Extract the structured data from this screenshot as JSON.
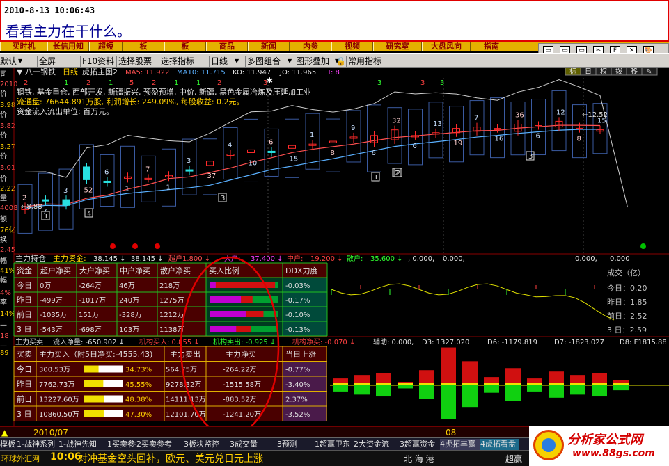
{
  "annotation": {
    "datetime": "2010-8-13 10:06:43",
    "note": "看看主力在干什么。"
  },
  "menubar": [
    "买时机",
    "长信用知",
    "超短",
    "板",
    "板",
    "商品",
    "新闻",
    "内参",
    "视频",
    "研究室",
    "大盘风向",
    "指南"
  ],
  "toolbar": {
    "items": [
      "默认",
      "全屏",
      "F10资料",
      "选择股票",
      "选择指标",
      "日线",
      "多图组合",
      "图形叠加",
      "常用指标"
    ]
  },
  "window_buttons": [
    "▭",
    "▭",
    "▭",
    "✂",
    "F",
    "✕",
    "🎨"
  ],
  "stock": {
    "name": "八一钢铁",
    "period": "日线",
    "main_title": "虎拓主图2",
    "ma": [
      {
        "label": "MA5: 11.922",
        "color": "#ff5050"
      },
      {
        "label": "MA10: 11.715",
        "color": "#5ab0ff"
      },
      {
        "label": "KO: 11.947",
        "color": "#e8e8e8"
      },
      {
        "label": "JO: 11.965",
        "color": "#e8e8e8"
      },
      {
        "label": "T: 8",
        "color": "#ff40ff"
      }
    ],
    "tabs": [
      "标",
      "日",
      "权",
      "拨",
      "移",
      "✎"
    ],
    "concept": "钢铁, 基金重仓, 西部开发, 新疆振兴, 预盈预增, 中价, 新疆, 黑色金属冶炼及压延加工业",
    "float_shares": "流通盘: 76644.891万股, 利润增长: 249.09%, 每股收益: 0.2元。",
    "unit_note": "资金流入流出单位: 百万元。"
  },
  "left_labels": [
    "司",
    "2010",
    "价",
    "3.98",
    "价",
    "3.82",
    "价",
    "3.27",
    "价",
    "3.01",
    "价",
    "2.22",
    "量",
    "4008",
    "额",
    "76亿",
    "换",
    "2.45",
    "幅",
    "41%",
    "幅",
    "4%",
    "率",
    "14%",
    "—",
    "18",
    "—",
    "89"
  ],
  "cycle_numbers": [
    {
      "t": "2",
      "c": "#ff4040"
    },
    {
      "t": "1",
      "c": "#30ff30"
    },
    {
      "t": "2",
      "c": "#ff4040"
    },
    {
      "t": "1",
      "c": "#30ff30"
    },
    {
      "t": "5",
      "c": "#ff4040"
    },
    {
      "t": "2",
      "c": "#ff4040"
    },
    {
      "t": "1",
      "c": "#30ff30"
    },
    {
      "t": "1",
      "c": "#30ff30"
    },
    {
      "t": "2",
      "c": "#ff4040"
    },
    {
      "t": "3",
      "c": "#ff4040"
    },
    {
      "t": "3",
      "c": "#30ff30"
    },
    {
      "t": "3",
      "c": "#ff4040"
    },
    {
      "t": "3",
      "c": "#30ff30"
    }
  ],
  "candle_labels": [
    "2",
    "7",
    "3",
    "52",
    "6",
    "1",
    "7",
    "1",
    "3",
    "37",
    "4",
    "10",
    "6",
    "15",
    "1",
    "8",
    "9",
    "6",
    "32",
    "6",
    "13",
    "19",
    "7",
    "16",
    "36",
    "6",
    "12",
    "8",
    "15"
  ],
  "box_labels": [
    "1",
    "4",
    "3",
    "2",
    "1",
    "2",
    "3"
  ],
  "price_marks": {
    "low": "←8.88",
    "high": "←12.52"
  },
  "capital_strip": {
    "title": "主力持仓",
    "label1": "主力资金:",
    "v1": "38.145",
    "v2": "38.145",
    "label3": "超户",
    "v3": "1.800",
    "label4": "大户:",
    "v4": "37.400",
    "label5": "中户:",
    "v5": "19.200",
    "label6": "散户:",
    "v6": "35.600",
    "v7": "0.000",
    "v8": "0.000",
    "v9": "0.000",
    "v10": "0.000"
  },
  "fund_table": {
    "headers": [
      "资金",
      "超户净买",
      "大户净买",
      "中户净买",
      "散户净买",
      "买入比例",
      "DDX力度"
    ],
    "rows": [
      {
        "label": "今日",
        "c1": "0万",
        "c2": "-264万",
        "c3": "46万",
        "c4": "218万",
        "ddx": "-0.03%",
        "bar": [
          0.08,
          0.95
        ]
      },
      {
        "label": "昨日",
        "c1": "-499万",
        "c2": "-1017万",
        "c3": "240万",
        "c4": "1275万",
        "ddx": "-0.17%",
        "bar": [
          0.45,
          0.62
        ]
      },
      {
        "label": "前日",
        "c1": "-1035万",
        "c2": "151万",
        "c3": "-328万",
        "c4": "1212万",
        "ddx": "-0.10%",
        "bar": [
          0.52,
          0.78
        ]
      },
      {
        "label": "3 日",
        "c1": "-543万",
        "c2": "-698万",
        "c3": "103万",
        "c4": "1138万",
        "ddx": "-0.13%",
        "bar": [
          0.38,
          0.6
        ]
      }
    ]
  },
  "volume_box": {
    "title": "成交（亿）",
    "today": "今日：0.20",
    "yest": "昨日：1.85",
    "prev": "前日：2.52",
    "three": "3 日：2.59"
  },
  "flow_strip": {
    "title": "主力买卖",
    "a": "流入净量: -650.902",
    "b": "机构买入: 0.855",
    "c": "机构卖出: -0.925",
    "d": "机构净买: -0.070",
    "e": "辅助: 0.000,",
    "f": "D3: 1327.020",
    "g": "D6: -1179.819",
    "h": "D7: -1823.027",
    "i": "D8: F1815.88"
  },
  "main_table": {
    "headers": [
      "买卖",
      "主力买入（附5日净买:-4555.43)",
      "主力卖出",
      "主力净买",
      "当日上涨"
    ],
    "rows": [
      {
        "label": "今日",
        "buy": "300.53万",
        "pct": "34.73%",
        "sell": "564.75万",
        "net": "-264.22万",
        "up": "-0.77%",
        "frac": 0.35
      },
      {
        "label": "昨日",
        "buy": "7762.73万",
        "pct": "45.55%",
        "sell": "9278.32万",
        "net": "-1515.58万",
        "up": "-3.40%",
        "frac": 0.46
      },
      {
        "label": "前日",
        "buy": "13227.60万",
        "pct": "48.38%",
        "sell": "14111.13万",
        "net": "-883.52万",
        "up": "2.37%",
        "frac": 0.48
      },
      {
        "label": "3 日",
        "buy": "10860.50万",
        "pct": "47.30%",
        "sell": "12101.70万",
        "net": "-1241.20万",
        "up": "-3.52%",
        "frac": 0.47
      }
    ]
  },
  "time_axis": {
    "left": "2010/07",
    "right": "08"
  },
  "tabs_bottom": [
    "模板",
    "1-战神系列",
    "1-战神先知",
    "1买卖参考",
    "2买卖参考",
    "3板块监控",
    "3成交量",
    "3预测",
    "1超赢卫东",
    "2大资金流",
    "3超赢资金",
    "4虎拓丰赢",
    "4虎拓看盘"
  ],
  "status": {
    "left": "环球外汇网",
    "time": "10:06",
    "news": "对冲基金空头回补，欧元、美元兑日元上涨",
    "right": "北 海 港",
    "right2": "超赢"
  },
  "logo": {
    "title": "分析家公式网",
    "url": "www.88gs.com"
  },
  "colors": {
    "up": "#ff2a2a",
    "down": "#28e0e0",
    "ma5": "#ff5050",
    "ma10": "#5ab0ff",
    "panel_bg": "#4a0000",
    "grid": "#c00000"
  },
  "chart_data": {
    "type": "candlestick",
    "closes": [
      9.3,
      9.5,
      9.35,
      10.25,
      10.15,
      10.35,
      10.3,
      10.4,
      10.55,
      10.9,
      11.15,
      11.3,
      11.2,
      11.45,
      11.5,
      11.6,
      11.75,
      11.8,
      12.0,
      11.8,
      11.9,
      12.05,
      12.1,
      12.05,
      12.2,
      12.15,
      12.3,
      12.1,
      12.0
    ],
    "opens": [
      9.2,
      9.55,
      9.55,
      10.7,
      10.2,
      10.3,
      10.3,
      10.35,
      10.6,
      10.75,
      11.1,
      11.2,
      11.25,
      11.35,
      11.45,
      11.55,
      11.7,
      11.55,
      11.65,
      11.8,
      11.85,
      11.9,
      11.95,
      12.05,
      11.95,
      12.15,
      12.1,
      12.05,
      12.0
    ],
    "volume_bars": [
      0.1,
      0.15,
      0.18,
      0.05,
      0.22,
      0.55,
      0.35,
      0.12,
      0.25,
      0.1,
      0.2,
      0.15,
      0.18,
      0.08
    ],
    "volume_sign": [
      1,
      1,
      -1,
      1,
      -1,
      1,
      1,
      -1,
      1,
      1,
      -1,
      1,
      -1,
      1
    ]
  }
}
